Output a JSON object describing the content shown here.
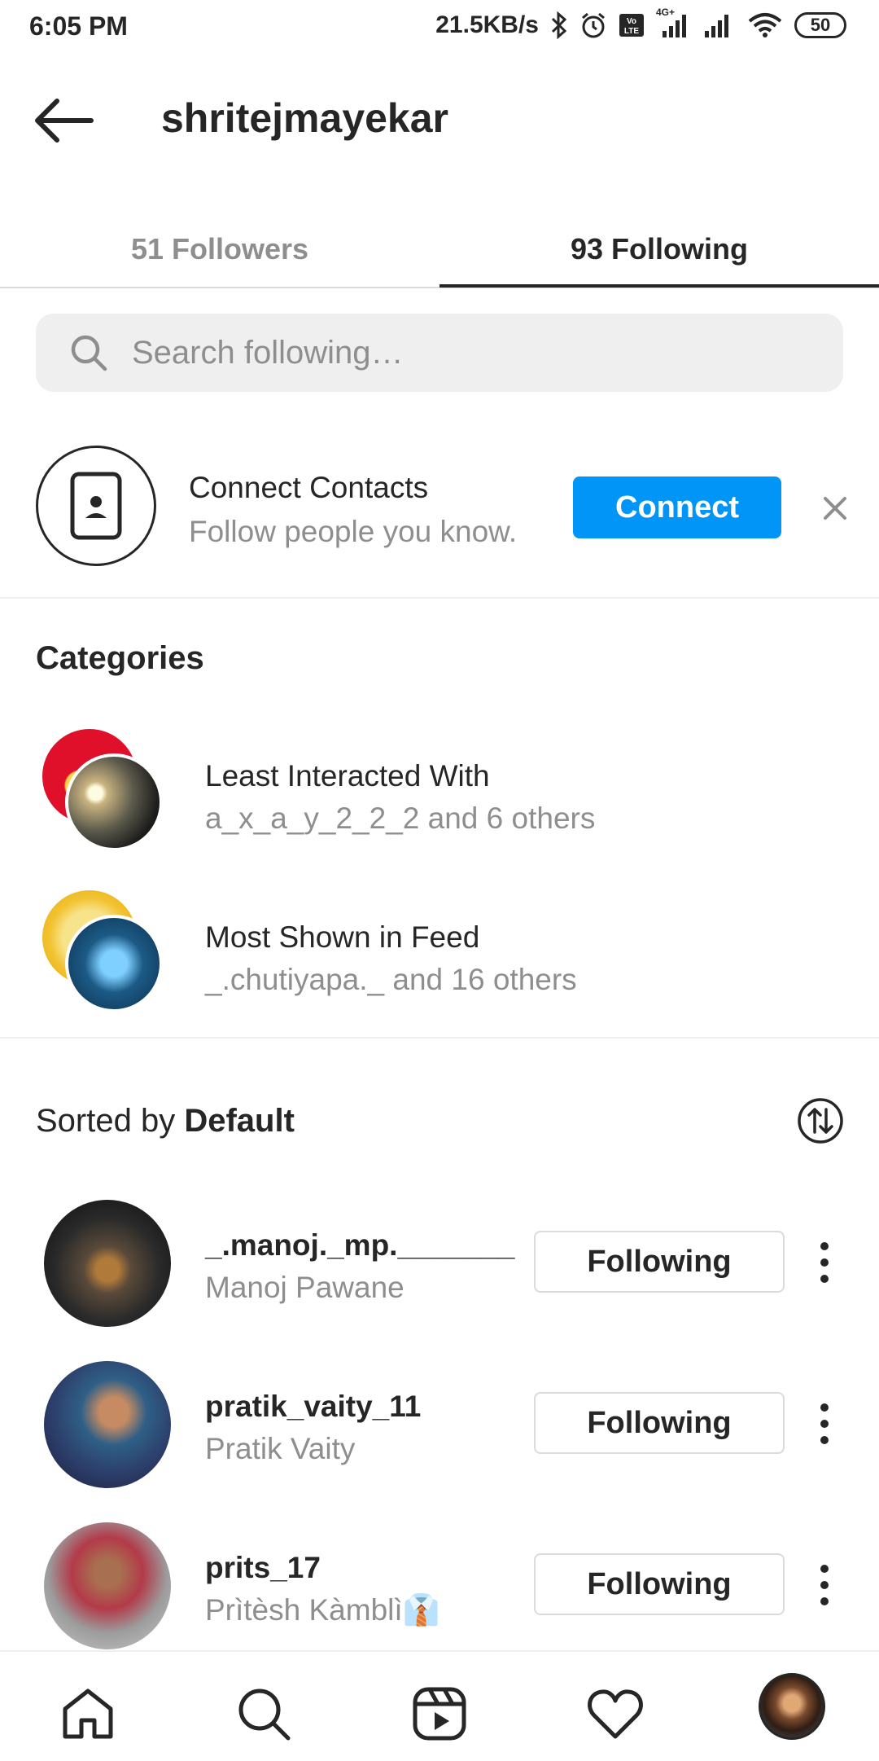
{
  "status_bar": {
    "time": "6:05 PM",
    "speed": "21.5KB/s",
    "battery": "50",
    "network_badge": "4G+"
  },
  "header": {
    "title": "shritejmayekar"
  },
  "tabs": [
    {
      "label": "51 Followers",
      "active": false
    },
    {
      "label": "93 Following",
      "active": true
    }
  ],
  "search": {
    "placeholder": "Search following…",
    "value": ""
  },
  "connect_contacts": {
    "title": "Connect Contacts",
    "subtitle": "Follow people you know.",
    "button_label": "Connect"
  },
  "categories": {
    "title": "Categories",
    "items": [
      {
        "title": "Least Interacted With",
        "subtitle": "a_x_a_y_2_2_2 and 6 others"
      },
      {
        "title": "Most Shown in Feed",
        "subtitle": "_.chutiyapa._ and 16 others"
      }
    ]
  },
  "sort": {
    "prefix": "Sorted by ",
    "value": "Default"
  },
  "following_list": [
    {
      "username": "_.manoj._mp._______",
      "name": "Manoj Pawane",
      "button": "Following"
    },
    {
      "username": "pratik_vaity_11",
      "name": "Pratik Vaity",
      "button": "Following"
    },
    {
      "username": "prits_17",
      "name": "Prìtèsh Kàmblì👔",
      "button": "Following"
    }
  ],
  "bottom_nav": [
    "home-icon",
    "search-icon",
    "reels-icon",
    "heart-icon",
    "profile-avatar"
  ],
  "colors": {
    "accent": "#0095f6",
    "text_primary": "#262626",
    "text_secondary": "#8e8e8e",
    "divider": "#dbdbdb"
  }
}
